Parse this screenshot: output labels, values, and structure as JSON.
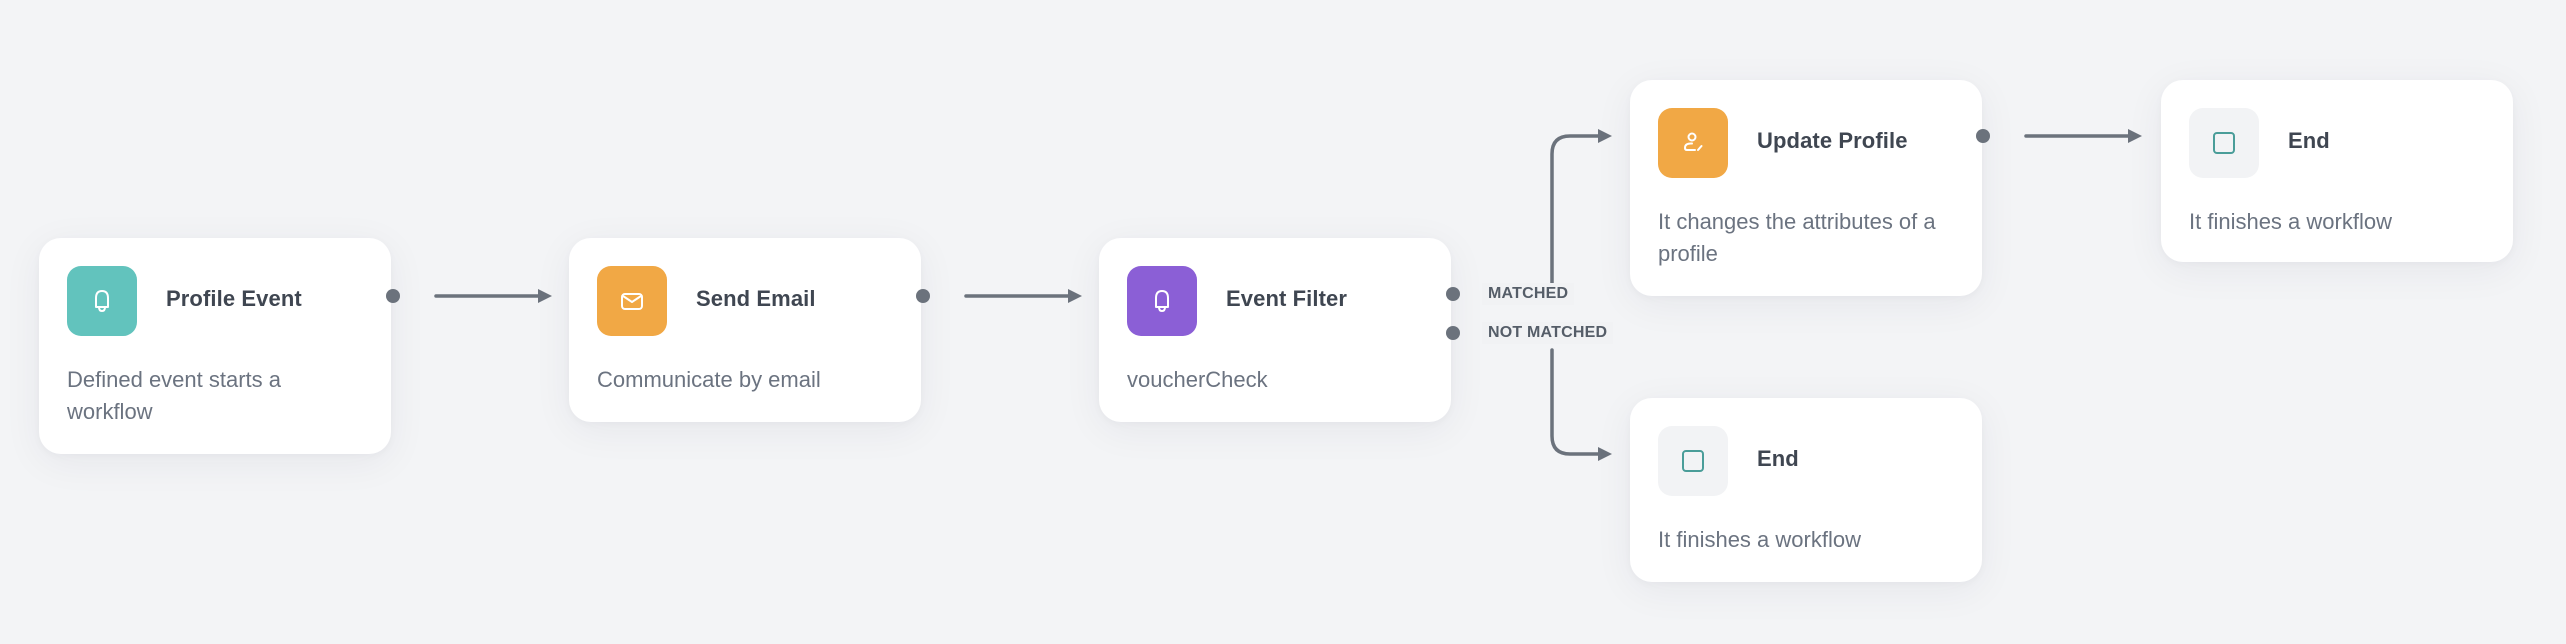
{
  "colors": {
    "background": "#f3f4f6",
    "card": "#ffffff",
    "connector": "#6b727c",
    "title_text": "#3f4651",
    "description_text": "#6b7380",
    "teal": "#62c3bd",
    "orange": "#f1a845",
    "purple": "#8b5fd6",
    "end_tile": "#f2f3f5",
    "end_icon_stroke": "#4a9d99"
  },
  "nodes": [
    {
      "id": "profile-event",
      "title": "Profile Event",
      "description": "Defined event starts a workflow",
      "icon": "bell-icon",
      "icon_bg": "#62c3bd"
    },
    {
      "id": "send-email",
      "title": "Send Email",
      "description": "Communicate by email",
      "icon": "envelope-icon",
      "icon_bg": "#f1a845"
    },
    {
      "id": "event-filter",
      "title": "Event Filter",
      "description": "voucherCheck",
      "icon": "bell-icon",
      "icon_bg": "#8b5fd6"
    },
    {
      "id": "update-profile",
      "title": "Update Profile",
      "description": "It changes the attributes of a profile",
      "icon": "user-edit-icon",
      "icon_bg": "#f1a845"
    },
    {
      "id": "end-1",
      "title": "End",
      "description": "It finishes a workflow",
      "icon": "stop-square-icon",
      "icon_bg": "#f2f3f5"
    },
    {
      "id": "end-2",
      "title": "End",
      "description": "It finishes a workflow",
      "icon": "stop-square-icon",
      "icon_bg": "#f2f3f5"
    }
  ],
  "branches": {
    "matched": "MATCHED",
    "not_matched": "NOT MATCHED"
  },
  "edges": [
    {
      "from": "profile-event",
      "to": "send-email"
    },
    {
      "from": "send-email",
      "to": "event-filter"
    },
    {
      "from": "event-filter",
      "to": "update-profile",
      "branch": "MATCHED"
    },
    {
      "from": "event-filter",
      "to": "end-2",
      "branch": "NOT MATCHED"
    },
    {
      "from": "update-profile",
      "to": "end-1"
    }
  ]
}
